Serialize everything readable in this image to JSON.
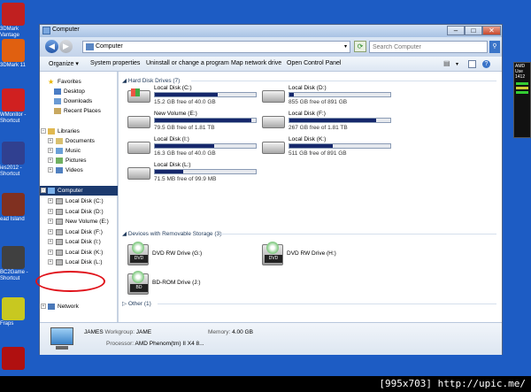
{
  "desktop": {
    "icons": [
      {
        "label": "3DMark\nVantage",
        "color": "#c02020"
      },
      {
        "label": "3DMark 11",
        "color": "#e06010"
      },
      {
        "label": "WMonitor -\nShortcut",
        "color": "#d02020"
      },
      {
        "label": "ies2012 -\nShortcut",
        "color": "#304090"
      },
      {
        "label": "ead Island",
        "color": "#803020"
      },
      {
        "label": "BC2Game -\nShortcut",
        "color": "#404040"
      },
      {
        "label": "Fraps",
        "color": "#c8c820"
      },
      {
        "label": "",
        "color": "#b01010"
      }
    ],
    "gadget_label": "AMD\nUse\n1412"
  },
  "watermark": "[995x703] http://upic.me/",
  "window": {
    "title": "Computer",
    "address": "Computer",
    "search_placeholder": "Search Computer",
    "buttons": {
      "min": "–",
      "max": "□",
      "close": "✕"
    },
    "toolbar": [
      "Organize ▾",
      "System properties",
      "Uninstall or change a program",
      "Map network drive",
      "Open Control Panel"
    ],
    "nav": {
      "favorites": "Favorites",
      "desktop": "Desktop",
      "downloads": "Downloads",
      "recent": "Recent Places",
      "libraries": "Libraries",
      "documents": "Documents",
      "music": "Music",
      "pictures": "Pictures",
      "videos": "Videos",
      "computer": "Computer",
      "drives": [
        "Local Disk (C:)",
        "Local Disk (D:)",
        "New Volume (E:)",
        "Local Disk (F:)",
        "Local Disk (I:)",
        "Local Disk (K:)",
        "Local Disk (L:)"
      ],
      "network": "Network"
    },
    "groups": {
      "hdd": "Hard Disk Drives (7)",
      "removable": "Devices with Removable Storage (3)",
      "other": "Other (1)"
    },
    "drives": [
      {
        "name": "Local Disk (C:)",
        "free": "15.2 GB free of 40.0 GB",
        "used_fraction": 0.62
      },
      {
        "name": "Local Disk (D:)",
        "free": "855 GB free of 891 GB",
        "used_fraction": 0.04
      },
      {
        "name": "New Volume (E:)",
        "free": "79.5 GB free of 1.81 TB",
        "used_fraction": 0.96
      },
      {
        "name": "Local Disk (F:)",
        "free": "267 GB free of 1.81 TB",
        "used_fraction": 0.86
      },
      {
        "name": "Local Disk (I:)",
        "free": "16.3 GB free of 40.0 GB",
        "used_fraction": 0.59
      },
      {
        "name": "Local Disk (K:)",
        "free": "511 GB free of 891 GB",
        "used_fraction": 0.43
      },
      {
        "name": "Local Disk (L:)",
        "free": "71.5 MB free of 99.9 MB",
        "used_fraction": 0.28
      }
    ],
    "removable": [
      {
        "name": "DVD RW Drive (G:)",
        "badge": "DVD"
      },
      {
        "name": "DVD RW Drive (H:)",
        "badge": "DVD"
      },
      {
        "name": "BD-ROM Drive (J:)",
        "badge": "BD"
      }
    ],
    "details": {
      "computer_name": "JAMES",
      "workgroup_label": "Workgroup:",
      "workgroup": "JAME",
      "memory_label": "Memory:",
      "memory": "4.00 GB",
      "processor_label": "Processor:",
      "processor": "AMD Phenom(tm) II X4 8..."
    }
  }
}
